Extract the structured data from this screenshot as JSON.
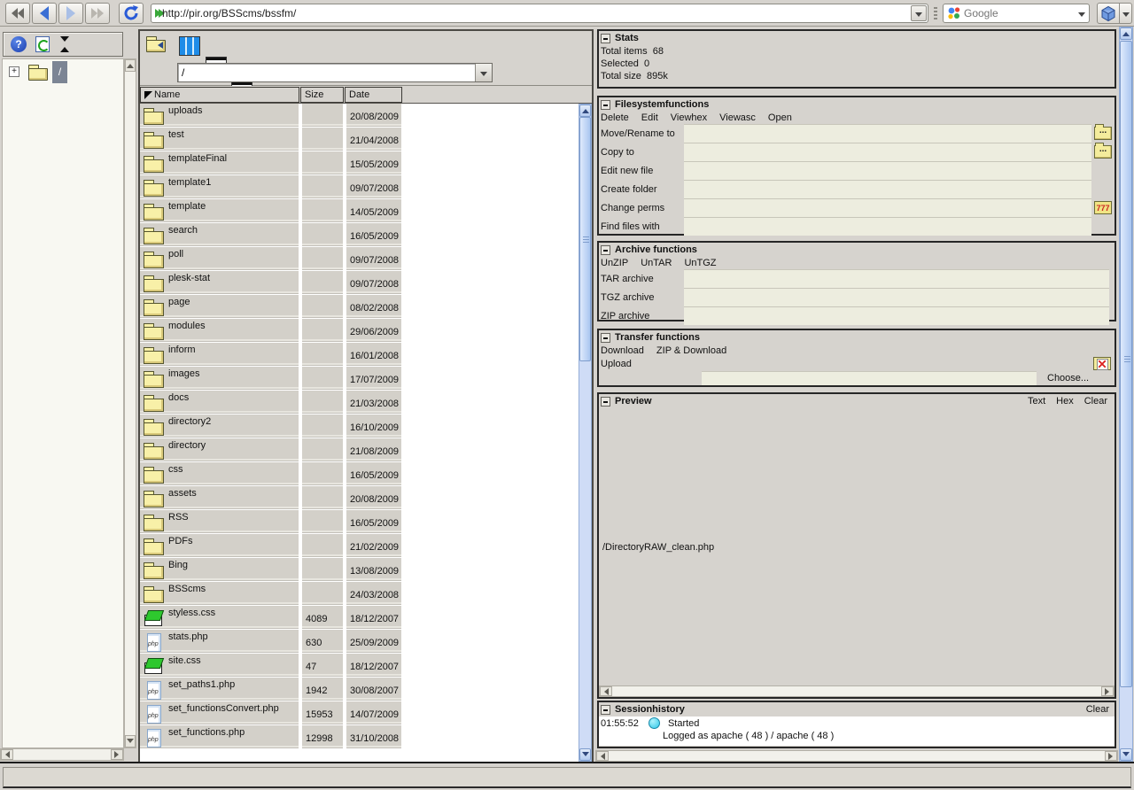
{
  "ui": {
    "help_glyph": "?",
    "expander_glyph": "+"
  },
  "browser": {
    "url": "http://pir.org/BSScms/bssfm/",
    "search_placeholder": "Google"
  },
  "left_panel": {
    "root_label": "/"
  },
  "fm_toolbar": {
    "path_value": "/"
  },
  "file_list": {
    "columns": {
      "name": "Name",
      "size": "Size",
      "date": "Date"
    },
    "items": [
      {
        "type": "folder",
        "name": "uploads",
        "size": "",
        "date": "20/08/2009"
      },
      {
        "type": "folder",
        "name": "test",
        "size": "",
        "date": "21/04/2008"
      },
      {
        "type": "folder",
        "name": "templateFinal",
        "size": "",
        "date": "15/05/2009"
      },
      {
        "type": "folder",
        "name": "template1",
        "size": "",
        "date": "09/07/2008"
      },
      {
        "type": "folder",
        "name": "template",
        "size": "",
        "date": "14/05/2009"
      },
      {
        "type": "folder",
        "name": "search",
        "size": "",
        "date": "16/05/2009"
      },
      {
        "type": "folder",
        "name": "poll",
        "size": "",
        "date": "09/07/2008"
      },
      {
        "type": "folder",
        "name": "plesk-stat",
        "size": "",
        "date": "09/07/2008"
      },
      {
        "type": "folder",
        "name": "page",
        "size": "",
        "date": "08/02/2008"
      },
      {
        "type": "folder",
        "name": "modules",
        "size": "",
        "date": "29/06/2009"
      },
      {
        "type": "folder",
        "name": "inform",
        "size": "",
        "date": "16/01/2008"
      },
      {
        "type": "folder",
        "name": "images",
        "size": "",
        "date": "17/07/2009"
      },
      {
        "type": "folder",
        "name": "docs",
        "size": "",
        "date": "21/03/2008"
      },
      {
        "type": "folder",
        "name": "directory2",
        "size": "",
        "date": "16/10/2009"
      },
      {
        "type": "folder",
        "name": "directory",
        "size": "",
        "date": "21/08/2009"
      },
      {
        "type": "folder",
        "name": "css",
        "size": "",
        "date": "16/05/2009"
      },
      {
        "type": "folder",
        "name": "assets",
        "size": "",
        "date": "20/08/2009"
      },
      {
        "type": "folder",
        "name": "RSS",
        "size": "",
        "date": "16/05/2009"
      },
      {
        "type": "folder",
        "name": "PDFs",
        "size": "",
        "date": "21/02/2009"
      },
      {
        "type": "folder",
        "name": "Bing",
        "size": "",
        "date": "13/08/2009"
      },
      {
        "type": "folder",
        "name": "BSScms",
        "size": "",
        "date": "24/03/2008"
      },
      {
        "type": "css",
        "name": "styless.css",
        "size": "4089",
        "date": "18/12/2007"
      },
      {
        "type": "php",
        "name": "stats.php",
        "size": "630",
        "date": "25/09/2009",
        "icon_label": "php"
      },
      {
        "type": "css",
        "name": "site.css",
        "size": "47",
        "date": "18/12/2007"
      },
      {
        "type": "php",
        "name": "set_paths1.php",
        "size": "1942",
        "date": "30/08/2007",
        "icon_label": "php"
      },
      {
        "type": "php",
        "name": "set_functionsConvert.php",
        "size": "15953",
        "date": "14/07/2009",
        "icon_label": "php"
      },
      {
        "type": "php",
        "name": "set_functions.php",
        "size": "12998",
        "date": "31/10/2008",
        "icon_label": "php"
      }
    ]
  },
  "stats": {
    "title": "Stats",
    "lines": [
      {
        "label": "Total items",
        "value": "68"
      },
      {
        "label": "Selected",
        "value": "0"
      },
      {
        "label": "Total size",
        "value": "895k"
      }
    ]
  },
  "fs_functions": {
    "title": "Filesystemfunctions",
    "actions": [
      "Delete",
      "Edit",
      "Viewhex",
      "Viewasc",
      "Open"
    ],
    "fields": [
      {
        "label": "Move/Rename to",
        "icon": "browse",
        "icon_label": "..."
      },
      {
        "label": "Copy to",
        "icon": "browse",
        "icon_label": "..."
      },
      {
        "label": "Edit new file",
        "icon": "none",
        "icon_label": ""
      },
      {
        "label": "Create folder",
        "icon": "none",
        "icon_label": ""
      },
      {
        "label": "Change perms",
        "icon": "perms",
        "icon_label": "777"
      },
      {
        "label": "Find files with",
        "icon": "none",
        "icon_label": ""
      }
    ]
  },
  "archive_functions": {
    "title": "Archive functions",
    "actions": [
      "UnZIP",
      "UnTAR",
      "UnTGZ"
    ],
    "fields": [
      {
        "label": "TAR archive",
        "icon": "none",
        "icon_label": ""
      },
      {
        "label": "TGZ archive",
        "icon": "none",
        "icon_label": ""
      },
      {
        "label": "ZIP archive",
        "icon": "none",
        "icon_label": ""
      }
    ]
  },
  "transfer_functions": {
    "title": "Transfer functions",
    "actions": [
      "Download",
      "ZIP & Download"
    ],
    "upload_label": "Upload",
    "choose_label": "Choose..."
  },
  "preview": {
    "title": "Preview",
    "actions": [
      "Text",
      "Hex",
      "Clear"
    ],
    "content": "/DirectoryRAW_clean.php"
  },
  "session": {
    "title": "Sessionhistory",
    "clear_label": "Clear",
    "entry_time": "01:55:52",
    "entry_line1": "Started",
    "entry_line2": "Logged as apache ( 48 ) / apache ( 48 )"
  }
}
